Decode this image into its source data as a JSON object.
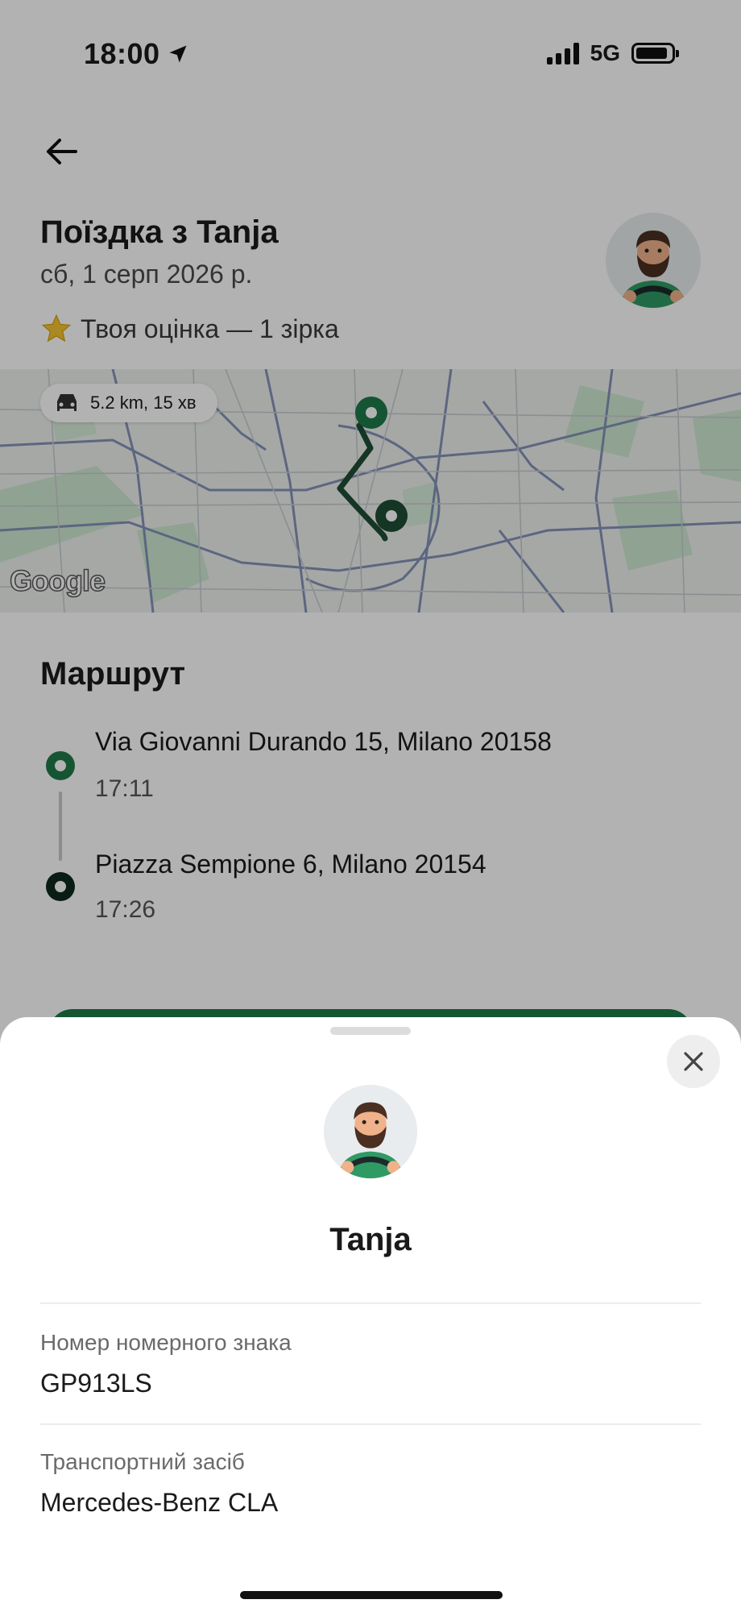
{
  "status_bar": {
    "time": "18:00",
    "network": "5G",
    "icons": [
      "location-arrow-icon",
      "signal-icon",
      "battery-icon"
    ]
  },
  "header": {
    "back_icon": "arrow-left-icon",
    "title": "Поїздка з Tanja",
    "date": "сб, 1 серп 2026 р.",
    "rating_icon": "star-icon",
    "rating_text": "Твоя оцінка — 1 зірка"
  },
  "map": {
    "route_chip_icon": "car-icon",
    "route_summary": "5.2 km, 15 хв",
    "attribution": "Google"
  },
  "route": {
    "heading": "Маршрут",
    "stops": [
      {
        "address": "Via Giovanni Durando 15, Milano 20158",
        "time": "17:11"
      },
      {
        "address": "Piazza Sempione 6, Milano 20154",
        "time": "17:26"
      }
    ]
  },
  "sheet": {
    "close_icon": "close-icon",
    "driver_name": "Tanja",
    "fields": [
      {
        "label": "Номер номерного знака",
        "value": "GP913LS"
      },
      {
        "label": "Транспортний засіб",
        "value": "Mercedes-Benz CLA"
      }
    ]
  },
  "colors": {
    "accent_green": "#1f7a4a",
    "dark_green": "#0f2a1e",
    "overlay": "rgba(0,0,0,0.30)"
  }
}
